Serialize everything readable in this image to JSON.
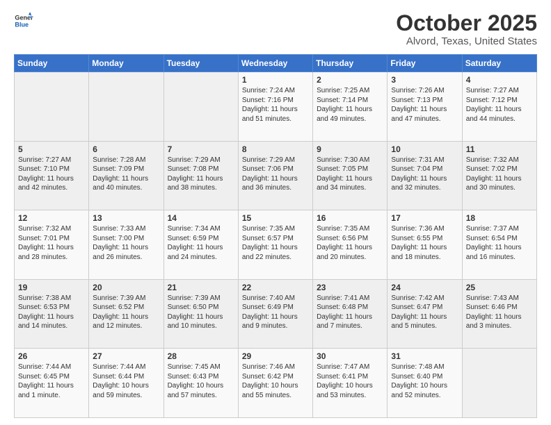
{
  "logo": {
    "line1": "General",
    "line2": "Blue"
  },
  "title": "October 2025",
  "location": "Alvord, Texas, United States",
  "days_header": [
    "Sunday",
    "Monday",
    "Tuesday",
    "Wednesday",
    "Thursday",
    "Friday",
    "Saturday"
  ],
  "weeks": [
    [
      {
        "num": "",
        "info": ""
      },
      {
        "num": "",
        "info": ""
      },
      {
        "num": "",
        "info": ""
      },
      {
        "num": "1",
        "info": "Sunrise: 7:24 AM\nSunset: 7:16 PM\nDaylight: 11 hours\nand 51 minutes."
      },
      {
        "num": "2",
        "info": "Sunrise: 7:25 AM\nSunset: 7:14 PM\nDaylight: 11 hours\nand 49 minutes."
      },
      {
        "num": "3",
        "info": "Sunrise: 7:26 AM\nSunset: 7:13 PM\nDaylight: 11 hours\nand 47 minutes."
      },
      {
        "num": "4",
        "info": "Sunrise: 7:27 AM\nSunset: 7:12 PM\nDaylight: 11 hours\nand 44 minutes."
      }
    ],
    [
      {
        "num": "5",
        "info": "Sunrise: 7:27 AM\nSunset: 7:10 PM\nDaylight: 11 hours\nand 42 minutes."
      },
      {
        "num": "6",
        "info": "Sunrise: 7:28 AM\nSunset: 7:09 PM\nDaylight: 11 hours\nand 40 minutes."
      },
      {
        "num": "7",
        "info": "Sunrise: 7:29 AM\nSunset: 7:08 PM\nDaylight: 11 hours\nand 38 minutes."
      },
      {
        "num": "8",
        "info": "Sunrise: 7:29 AM\nSunset: 7:06 PM\nDaylight: 11 hours\nand 36 minutes."
      },
      {
        "num": "9",
        "info": "Sunrise: 7:30 AM\nSunset: 7:05 PM\nDaylight: 11 hours\nand 34 minutes."
      },
      {
        "num": "10",
        "info": "Sunrise: 7:31 AM\nSunset: 7:04 PM\nDaylight: 11 hours\nand 32 minutes."
      },
      {
        "num": "11",
        "info": "Sunrise: 7:32 AM\nSunset: 7:02 PM\nDaylight: 11 hours\nand 30 minutes."
      }
    ],
    [
      {
        "num": "12",
        "info": "Sunrise: 7:32 AM\nSunset: 7:01 PM\nDaylight: 11 hours\nand 28 minutes."
      },
      {
        "num": "13",
        "info": "Sunrise: 7:33 AM\nSunset: 7:00 PM\nDaylight: 11 hours\nand 26 minutes."
      },
      {
        "num": "14",
        "info": "Sunrise: 7:34 AM\nSunset: 6:59 PM\nDaylight: 11 hours\nand 24 minutes."
      },
      {
        "num": "15",
        "info": "Sunrise: 7:35 AM\nSunset: 6:57 PM\nDaylight: 11 hours\nand 22 minutes."
      },
      {
        "num": "16",
        "info": "Sunrise: 7:35 AM\nSunset: 6:56 PM\nDaylight: 11 hours\nand 20 minutes."
      },
      {
        "num": "17",
        "info": "Sunrise: 7:36 AM\nSunset: 6:55 PM\nDaylight: 11 hours\nand 18 minutes."
      },
      {
        "num": "18",
        "info": "Sunrise: 7:37 AM\nSunset: 6:54 PM\nDaylight: 11 hours\nand 16 minutes."
      }
    ],
    [
      {
        "num": "19",
        "info": "Sunrise: 7:38 AM\nSunset: 6:53 PM\nDaylight: 11 hours\nand 14 minutes."
      },
      {
        "num": "20",
        "info": "Sunrise: 7:39 AM\nSunset: 6:52 PM\nDaylight: 11 hours\nand 12 minutes."
      },
      {
        "num": "21",
        "info": "Sunrise: 7:39 AM\nSunset: 6:50 PM\nDaylight: 11 hours\nand 10 minutes."
      },
      {
        "num": "22",
        "info": "Sunrise: 7:40 AM\nSunset: 6:49 PM\nDaylight: 11 hours\nand 9 minutes."
      },
      {
        "num": "23",
        "info": "Sunrise: 7:41 AM\nSunset: 6:48 PM\nDaylight: 11 hours\nand 7 minutes."
      },
      {
        "num": "24",
        "info": "Sunrise: 7:42 AM\nSunset: 6:47 PM\nDaylight: 11 hours\nand 5 minutes."
      },
      {
        "num": "25",
        "info": "Sunrise: 7:43 AM\nSunset: 6:46 PM\nDaylight: 11 hours\nand 3 minutes."
      }
    ],
    [
      {
        "num": "26",
        "info": "Sunrise: 7:44 AM\nSunset: 6:45 PM\nDaylight: 11 hours\nand 1 minute."
      },
      {
        "num": "27",
        "info": "Sunrise: 7:44 AM\nSunset: 6:44 PM\nDaylight: 10 hours\nand 59 minutes."
      },
      {
        "num": "28",
        "info": "Sunrise: 7:45 AM\nSunset: 6:43 PM\nDaylight: 10 hours\nand 57 minutes."
      },
      {
        "num": "29",
        "info": "Sunrise: 7:46 AM\nSunset: 6:42 PM\nDaylight: 10 hours\nand 55 minutes."
      },
      {
        "num": "30",
        "info": "Sunrise: 7:47 AM\nSunset: 6:41 PM\nDaylight: 10 hours\nand 53 minutes."
      },
      {
        "num": "31",
        "info": "Sunrise: 7:48 AM\nSunset: 6:40 PM\nDaylight: 10 hours\nand 52 minutes."
      },
      {
        "num": "",
        "info": ""
      }
    ]
  ]
}
